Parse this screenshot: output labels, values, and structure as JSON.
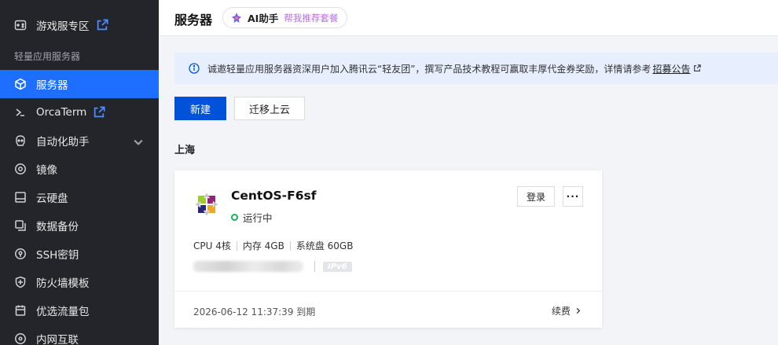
{
  "sidebar": {
    "top_item": {
      "label": "游戏服专区",
      "icon": "gamepad-icon"
    },
    "group_label": "轻量应用服务器",
    "items": [
      {
        "label": "服务器",
        "icon": "cube-icon",
        "active": true
      },
      {
        "label": "OrcaTerm",
        "icon": "terminal-icon",
        "external": true
      },
      {
        "label": "自动化助手",
        "icon": "robot-icon",
        "expandable": true
      },
      {
        "label": "镜像",
        "icon": "disc-icon"
      },
      {
        "label": "云硬盘",
        "icon": "disk-icon"
      },
      {
        "label": "数据备份",
        "icon": "backup-icon"
      },
      {
        "label": "SSH密钥",
        "icon": "key-icon"
      },
      {
        "label": "防火墙模板",
        "icon": "shield-icon"
      },
      {
        "label": "优选流量包",
        "icon": "package-icon"
      },
      {
        "label": "内网互联",
        "icon": "network-icon"
      }
    ]
  },
  "header": {
    "title": "服务器",
    "ai": {
      "name": "AI助手",
      "subtitle": "帮我推荐套餐"
    }
  },
  "notice": {
    "text": "诚邀轻量应用服务器资深用户加入腾讯云“轻友团”，撰写产品技术教程可赢取丰厚代金券奖励，详情请参考",
    "link": "招募公告"
  },
  "toolbar": {
    "create_label": "新建",
    "migrate_label": "迁移上云"
  },
  "region": "上海",
  "instance": {
    "name": "CentOS-F6sf",
    "status": "运行中",
    "login_label": "登录",
    "more_label": "···",
    "specs": {
      "cpu": "CPU 4核",
      "memory": "内存 4GB",
      "disk": "系统盘 60GB"
    },
    "ipv6_badge": "IPv6",
    "expire": "2026-06-12 11:37:39 到期",
    "renew_label": "续费"
  },
  "colors": {
    "accent": "#0052d9",
    "sidebar_bg": "#23252b",
    "active_item": "#1e6fff",
    "status_running": "#16b45b",
    "notice_bg": "#e7efff"
  }
}
